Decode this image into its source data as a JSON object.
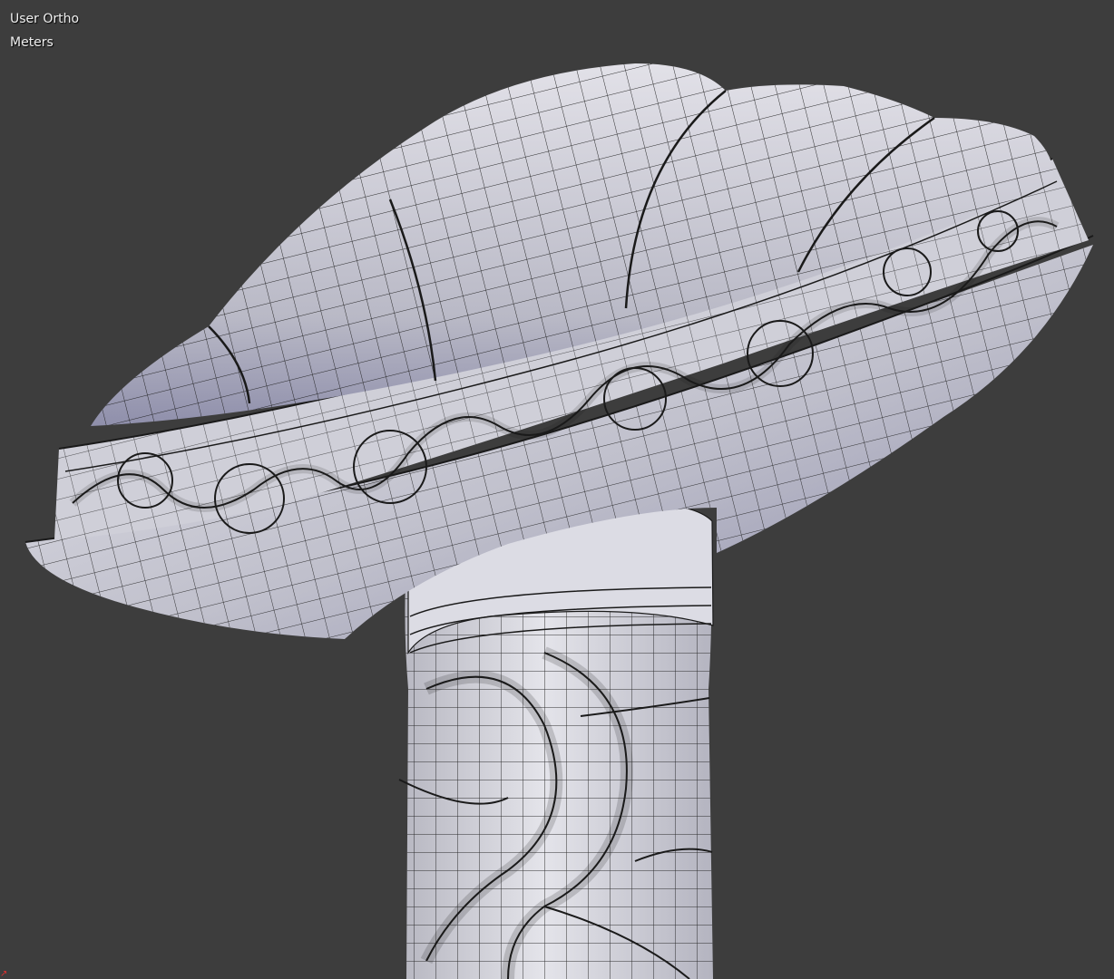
{
  "viewport": {
    "view_label": "User Ortho",
    "units_label": "Meters",
    "background_color": "#3d3d3d",
    "model": {
      "name_icon": "mushroom-cane-mesh",
      "shading": "solid-with-wireframe",
      "surface_color": "#c9c8d2",
      "shadow_color": "#8f8fab",
      "wire_color": "#1a1a1a"
    },
    "axis_indicator": {
      "icon": "z-axis-icon",
      "color": "#d83030"
    }
  }
}
